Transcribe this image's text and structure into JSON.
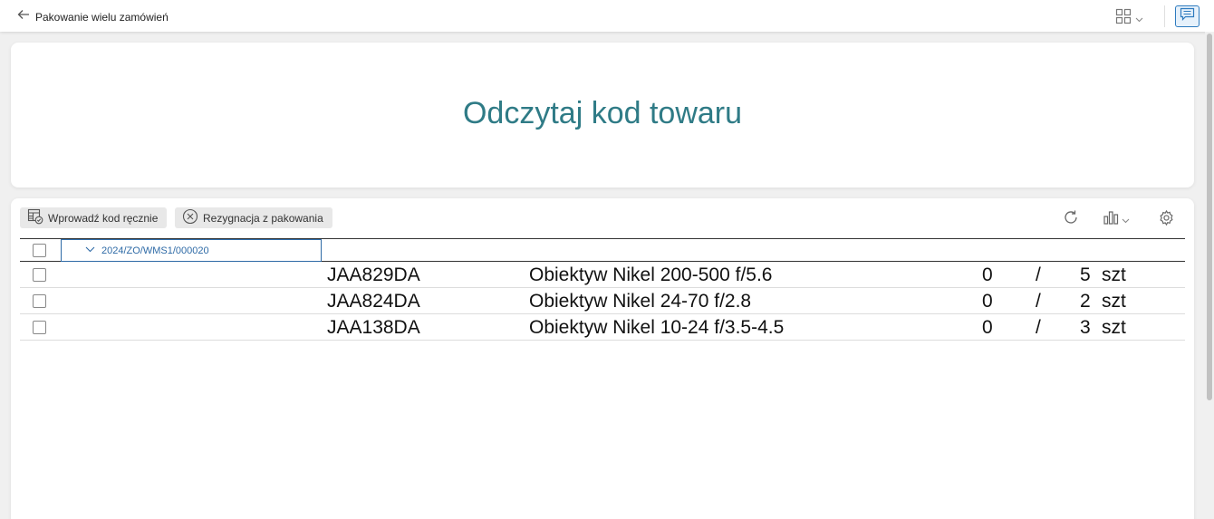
{
  "topbar": {
    "title": "Pakowanie wielu zamówień",
    "icons": [
      "arrow-left-icon",
      "layout-grid-icon",
      "chevron-down-icon",
      "chat-icon"
    ]
  },
  "scan": {
    "prompt": "Odczytaj kod towaru",
    "color": "#2f7b86"
  },
  "toolbar": {
    "manual_label": "Wprowadź kod ręcznie",
    "cancel_label": "Rezygnacja z pakowania"
  },
  "grid": {
    "group_label": "2024/ZO/WMS1/000020",
    "rows": [
      {
        "code": "JAA829DA",
        "name": "Obiektyw Nikel 200-500 f/5.6",
        "done": "0",
        "sep": "/",
        "total": "5",
        "unit": "szt"
      },
      {
        "code": "JAA824DA",
        "name": "Obiektyw Nikel 24-70 f/2.8",
        "done": "0",
        "sep": "/",
        "total": "2",
        "unit": "szt"
      },
      {
        "code": "JAA138DA",
        "name": "Obiektyw Nikel 10-24 f/3.5-4.5",
        "done": "0",
        "sep": "/",
        "total": "3",
        "unit": "szt"
      }
    ]
  },
  "colors": {
    "accent": "#2e6aa6",
    "prompt": "#2f7b86"
  }
}
